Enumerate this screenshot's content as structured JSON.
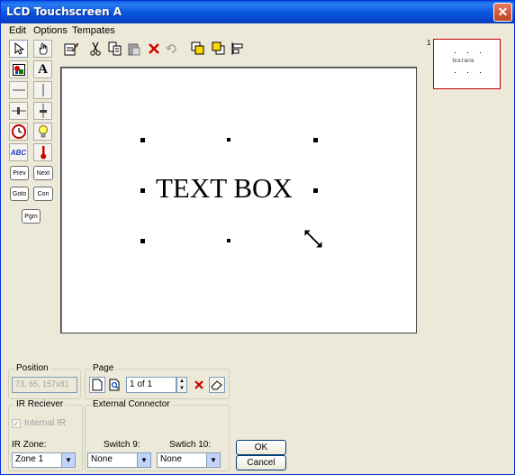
{
  "window": {
    "title": "LCD Touchscreen A",
    "close_glyph": "✕"
  },
  "menu": [
    "Edit",
    "Options",
    "Tempates"
  ],
  "palette": {
    "prev": "Prev",
    "next": "Next",
    "goto": "Goto",
    "con": "Con",
    "pgm": "Pgm",
    "icons": [
      "pointer-icon",
      "hand-icon",
      "image-icon",
      "text-icon",
      "hline-icon",
      "vline-icon",
      "hslider-icon",
      "vslider-icon",
      "clock-icon",
      "bulb-icon",
      "abc-text-icon",
      "thermometer-icon"
    ],
    "text_glyph": "A",
    "abc": "ABC"
  },
  "toolbar": {
    "icons": [
      "properties-icon",
      "cut-icon",
      "copy-icon",
      "paste-icon",
      "delete-icon",
      "undo-icon",
      "bring-front-icon",
      "send-back-icon",
      "align-icon"
    ]
  },
  "canvas": {
    "text_box": "TEXT BOX"
  },
  "thumbnail": {
    "page_number": "1",
    "text": "TEXT BOX"
  },
  "position": {
    "label": "Position",
    "value": "73, 65, 157x81"
  },
  "page": {
    "label": "Page",
    "value": "1 of 1"
  },
  "ir_receiver": {
    "label": "IR Reciever",
    "internal_ir": "Internal IR",
    "zone_label": "IR Zone:",
    "zone_value": "Zone 1"
  },
  "external": {
    "label": "External Connector",
    "switch9_label": "Switch 9:",
    "switch9_value": "None",
    "switch10_label": "Swtich 10:",
    "switch10_value": "None"
  },
  "buttons": {
    "ok": "OK",
    "cancel": "Cancel"
  },
  "colors": {
    "titlebar": "#0a5fe6",
    "face": "#ece9d8",
    "thumb_border": "#c40000"
  }
}
